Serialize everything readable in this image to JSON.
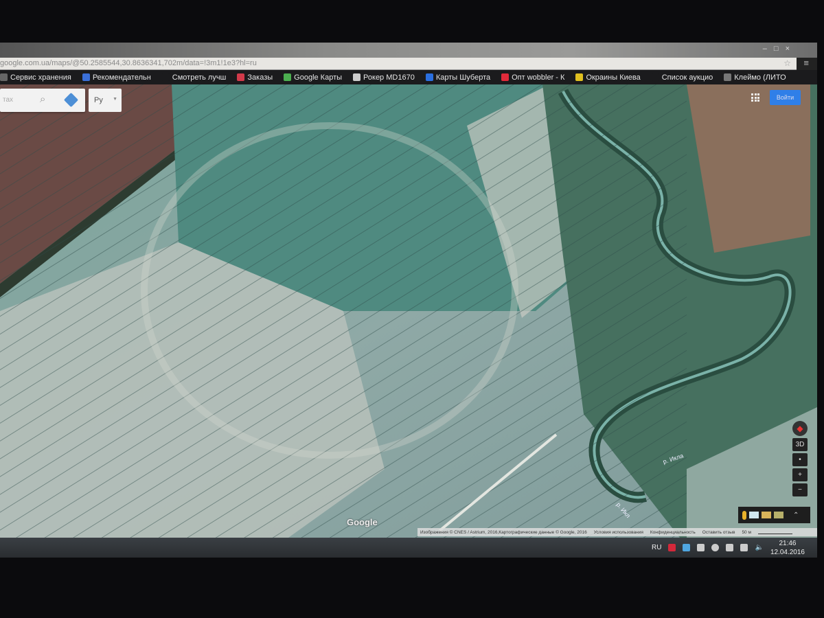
{
  "browser": {
    "url": "google.com.ua/maps/@50.2585544,30.8636341,702m/data=!3m1!1e3?hl=ru",
    "window_controls": [
      "–",
      "□",
      "×"
    ]
  },
  "bookmarks": [
    {
      "label": "Сервис хранения",
      "color": "#666"
    },
    {
      "label": "Рекомендательн",
      "color": "#3a6fd8"
    },
    {
      "label": "Смотреть лучш",
      "color": "#1b1b1d"
    },
    {
      "label": "Заказы",
      "color": "#d23a4a"
    },
    {
      "label": "Google Карты",
      "color": "#4caf50"
    },
    {
      "label": "Рокер MD1670",
      "color": "#ccc"
    },
    {
      "label": "Карты Шуберта",
      "color": "#2a6fe0"
    },
    {
      "label": "Опт wobbler - К",
      "color": "#e02a3a"
    },
    {
      "label": "Окраины Киева",
      "color": "#e0c020"
    },
    {
      "label": "Список аукцио",
      "color": "#1b1b1d"
    },
    {
      "label": "Клеймо (ЛИТО",
      "color": "#777"
    }
  ],
  "maps": {
    "search_placeholder": "тах",
    "language": "Ру",
    "signin": "Войти",
    "logo": "Google",
    "river_labels": [
      "р. Икла",
      "р. Икл"
    ],
    "controls": {
      "tilt": "3D",
      "center": "•",
      "zoom_in": "+",
      "zoom_out": "−",
      "expand": "⌃"
    },
    "attribution": {
      "imagery": "Изображения © CNES / Astrium, 2016,Картографические данные © Google, 2016",
      "terms": "Условия использования",
      "privacy": "Конфиденциальность",
      "feedback": "Оставить отзыв",
      "scale": "50 м"
    }
  },
  "taskbar": {
    "lang": "RU",
    "time": "21:46",
    "date": "12.04.2016"
  }
}
